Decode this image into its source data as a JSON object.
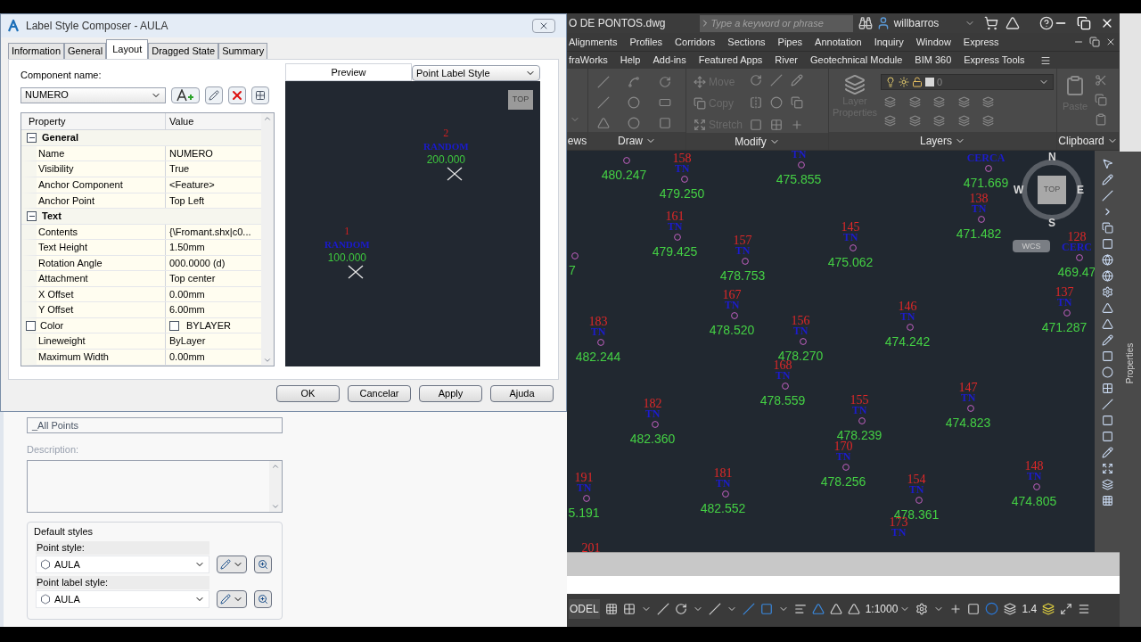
{
  "dialog": {
    "title": "Label Style Composer - AULA",
    "tabs": [
      {
        "label": "Information",
        "selected": false
      },
      {
        "label": "General",
        "selected": false
      },
      {
        "label": "Layout",
        "selected": true
      },
      {
        "label": "Dragged State",
        "selected": false
      },
      {
        "label": "Summary",
        "selected": false
      }
    ],
    "component_label": "Component name:",
    "component_value": "NUMERO",
    "property_grid": {
      "columns": [
        "Property",
        "Value"
      ],
      "rows": [
        {
          "kind": "category",
          "label": "General",
          "expanded": true
        },
        {
          "kind": "property",
          "label": "Name",
          "value": "NUMERO"
        },
        {
          "kind": "property",
          "label": "Visibility",
          "value": "True"
        },
        {
          "kind": "property",
          "label": "Anchor Component",
          "value": "<Feature>"
        },
        {
          "kind": "property",
          "label": "Anchor Point",
          "value": "Top Left"
        },
        {
          "kind": "category",
          "label": "Text",
          "expanded": true
        },
        {
          "kind": "property",
          "label": "Contents",
          "value": "{\\Fromant.shx|c0..."
        },
        {
          "kind": "property",
          "label": "Text Height",
          "value": "1.50mm"
        },
        {
          "kind": "property",
          "label": "Rotation Angle",
          "value": "000.0000 (d)"
        },
        {
          "kind": "property",
          "label": "Attachment",
          "value": "Top center"
        },
        {
          "kind": "property",
          "label": "X Offset",
          "value": "0.00mm"
        },
        {
          "kind": "property",
          "label": "Y Offset",
          "value": "6.00mm"
        },
        {
          "kind": "color",
          "label": "Color",
          "value": "BYLAYER",
          "checked": false
        },
        {
          "kind": "property",
          "label": "Lineweight",
          "value": "ByLayer"
        },
        {
          "kind": "property",
          "label": "Maximum Width",
          "value": "0.00mm"
        }
      ]
    },
    "preview": {
      "tab": "Preview",
      "style_select": "Point Label Style",
      "view_cube": "TOP",
      "points": [
        {
          "number": "2",
          "code": "RANDOM",
          "elevation": "200.000"
        },
        {
          "number": "1",
          "code": "RANDOM",
          "elevation": "100.000"
        }
      ]
    },
    "buttons": [
      "OK",
      "Cancelar",
      "Apply",
      "Ajuda"
    ]
  },
  "point_group_panel": {
    "name_value": "_All Points",
    "description": {
      "label": "Description:",
      "disabled": true
    },
    "group_title": "Default styles",
    "styles": [
      {
        "label": "Point style:",
        "value": "AULA"
      },
      {
        "label": "Point label style:",
        "value": "AULA"
      }
    ]
  },
  "app": {
    "file_title": "O DE PONTOS.dwg",
    "search_placeholder": "Type a keyword or phrase",
    "user": "willbarros",
    "menu_row_1": [
      "Alignments",
      "Profiles",
      "Corridors",
      "Sections",
      "Pipes",
      "Annotation",
      "Inquiry",
      "Window",
      "Express"
    ],
    "menu_row_2": [
      "fraWorks",
      "Help",
      "Add-ins",
      "Featured Apps",
      "River",
      "Geotechnical Module",
      "BIM 360",
      "Express Tools"
    ],
    "ribbon_panels": [
      {
        "kind": "stub",
        "title": "ews"
      },
      {
        "kind": "draw",
        "title": "Draw"
      },
      {
        "kind": "modify",
        "title": "Modify",
        "tools": [
          {
            "label": "Move",
            "disabled": true
          },
          {
            "label": "Copy",
            "disabled": true
          },
          {
            "label": "Stretch",
            "disabled": true
          }
        ]
      },
      {
        "kind": "layers",
        "title": "Layers",
        "tool": {
          "label": "Layer Properties",
          "disabled": true
        },
        "layer": "0"
      },
      {
        "kind": "clipboard",
        "title": "Clipboard",
        "tool": {
          "label": "Paste",
          "disabled": true
        }
      }
    ],
    "canvas": {
      "points": [
        {
          "elevation": "480.247"
        },
        {
          "number": "158",
          "code": "TN",
          "elevation": "479.250"
        },
        {
          "code": "TN",
          "elevation": "475.855"
        },
        {
          "code": "CERCA",
          "elevation": "471.669"
        },
        {
          "elevation": "7"
        },
        {
          "number": "161",
          "code": "TN",
          "elevation": "479.425"
        },
        {
          "number": "157",
          "code": "TN",
          "elevation": "478.753"
        },
        {
          "number": "145",
          "code": "TN",
          "elevation": "475.062"
        },
        {
          "number": "138",
          "code": "TN",
          "elevation": "471.482"
        },
        {
          "number": "128",
          "code": "CERC",
          "elevation": "469.47"
        },
        {
          "number": "183",
          "code": "TN",
          "elevation": "482.244"
        },
        {
          "number": "167",
          "code": "TN",
          "elevation": "478.520"
        },
        {
          "number": "156",
          "code": "TN",
          "elevation": "478.270"
        },
        {
          "number": "146",
          "code": "TN",
          "elevation": "474.242"
        },
        {
          "number": "137",
          "code": "TN",
          "elevation": "471.287"
        },
        {
          "number": "182",
          "code": "TN",
          "elevation": "482.360"
        },
        {
          "number": "168",
          "code": "TN",
          "elevation": "478.559"
        },
        {
          "number": "155",
          "code": "TN",
          "elevation": "478.239"
        },
        {
          "number": "147",
          "code": "TN",
          "elevation": "474.823"
        },
        {
          "number": "191",
          "code": "TN",
          "elevation": "5.191"
        },
        {
          "number": "181",
          "code": "TN",
          "elevation": "482.552"
        },
        {
          "number": "170",
          "code": "TN",
          "elevation": "478.256"
        },
        {
          "number": "154",
          "code": "TN",
          "elevation": "478.361"
        },
        {
          "number": "148",
          "code": "TN",
          "elevation": "474.805"
        },
        {
          "number": "201"
        },
        {
          "number": "173",
          "code": "TN"
        }
      ],
      "compass": [
        "N",
        "W",
        "E",
        "S"
      ],
      "view_cube": "TOP",
      "ucs": "WCS"
    },
    "side_palette": "Properties",
    "status_bar": {
      "model": "ODEL",
      "scale": "1:1000",
      "value": "1.4"
    }
  }
}
